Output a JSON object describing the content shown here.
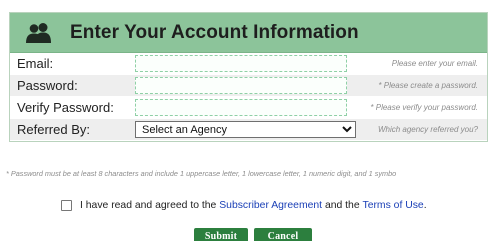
{
  "header": {
    "title": "Enter Your Account Information",
    "icon": "users-icon"
  },
  "form": {
    "email": {
      "label": "Email:",
      "value": "",
      "hint": "Please enter your email."
    },
    "password": {
      "label": "Password:",
      "value": "",
      "hint": "* Please create a password."
    },
    "verify_password": {
      "label": "Verify Password:",
      "value": "",
      "hint": "* Please verify your password."
    },
    "referred_by": {
      "label": "Referred By:",
      "selected": "Select an Agency",
      "hint": "Which agency referred you?"
    }
  },
  "password_note": "* Password must be at least 8 characters and include 1 uppercase letter, 1 lowercase letter, 1 numeric digit, and 1 symbo",
  "agreement": {
    "prefix": "I have read and agreed to the",
    "subscriber_link": "Subscriber Agreement",
    "middle": "and the",
    "terms_link": "Terms of Use",
    "suffix": "."
  },
  "buttons": {
    "submit": "Submit",
    "cancel": "Cancel"
  },
  "colors": {
    "header_bg": "#8cc49a",
    "button_bg": "#2c7f3e",
    "link": "#1a3fb6"
  }
}
